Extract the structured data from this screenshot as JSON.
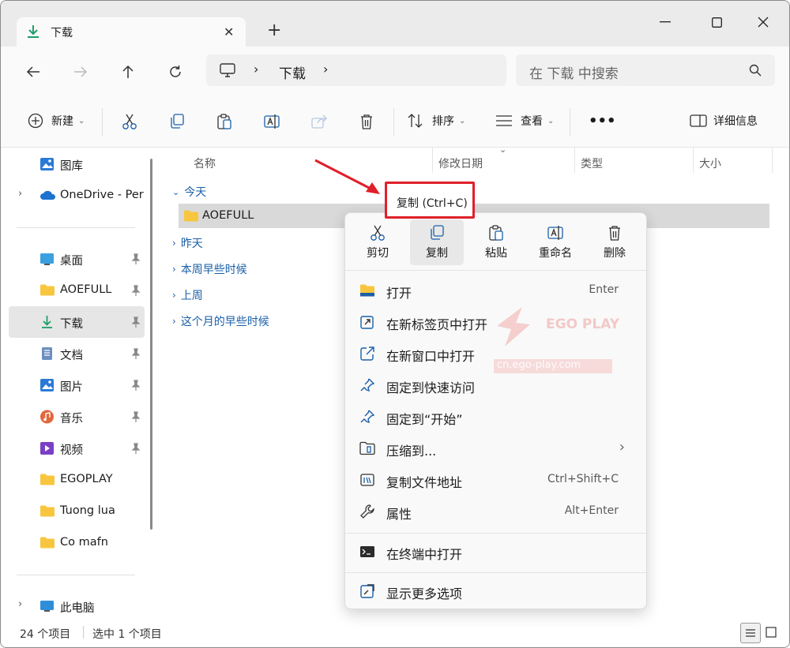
{
  "window": {
    "tab_title": "下载",
    "new_tab_symbol": "+"
  },
  "nav": {
    "address": "下载",
    "search_placeholder": "在 下载 中搜索"
  },
  "toolbar": {
    "new_label": "新建",
    "sort_label": "排序",
    "view_label": "查看",
    "more_label": "•••",
    "details_label": "详细信息"
  },
  "sidebar": {
    "items": [
      {
        "label": "图库",
        "icon": "gallery-icon"
      },
      {
        "label": "OneDrive - Per",
        "icon": "onedrive-icon"
      },
      {
        "label": "桌面",
        "icon": "desktop-icon"
      },
      {
        "label": "AOEFULL",
        "icon": "folder-icon"
      },
      {
        "label": "下载",
        "icon": "download-icon"
      },
      {
        "label": "文档",
        "icon": "document-icon"
      },
      {
        "label": "图片",
        "icon": "pictures-icon"
      },
      {
        "label": "音乐",
        "icon": "music-icon"
      },
      {
        "label": "视频",
        "icon": "video-icon"
      },
      {
        "label": "EGOPLAY",
        "icon": "folder-icon"
      },
      {
        "label": "Tuong lua",
        "icon": "folder-icon"
      },
      {
        "label": "Co mafn",
        "icon": "folder-icon"
      },
      {
        "label": "此电脑",
        "icon": "this-pc-icon"
      }
    ]
  },
  "columns": {
    "name": "名称",
    "modified": "修改日期",
    "type": "类型",
    "size": "大小"
  },
  "groups": {
    "today": "今天",
    "yesterday": "昨天",
    "earlier_week": "本周早些时候",
    "last_week": "上周",
    "earlier_month": "这个月的早些时候"
  },
  "files": [
    {
      "name": "AOEFULL"
    }
  ],
  "tooltip": {
    "text": "复制 (Ctrl+C)"
  },
  "context_menu": {
    "quick_actions": [
      {
        "label": "剪切",
        "icon": "cut-icon"
      },
      {
        "label": "复制",
        "icon": "copy-icon"
      },
      {
        "label": "粘贴",
        "icon": "paste-icon"
      },
      {
        "label": "重命名",
        "icon": "rename-icon"
      },
      {
        "label": "删除",
        "icon": "delete-icon"
      }
    ],
    "items": [
      {
        "label": "打开",
        "shortcut": "Enter",
        "icon": "open-folder-icon"
      },
      {
        "label": "在新标签页中打开",
        "shortcut": "",
        "icon": "new-tab-icon"
      },
      {
        "label": "在新窗口中打开",
        "shortcut": "",
        "icon": "new-window-icon"
      },
      {
        "label": "固定到快速访问",
        "shortcut": "",
        "icon": "pin-icon"
      },
      {
        "label": "固定到“开始”",
        "shortcut": "",
        "icon": "pin-start-icon"
      },
      {
        "label": "压缩到...",
        "shortcut": "",
        "icon": "compress-icon"
      },
      {
        "label": "复制文件地址",
        "shortcut": "Ctrl+Shift+C",
        "icon": "copy-path-icon"
      },
      {
        "label": "属性",
        "shortcut": "Alt+Enter",
        "icon": "properties-icon"
      },
      {
        "label": "在终端中打开",
        "shortcut": "",
        "icon": "terminal-icon"
      },
      {
        "label": "显示更多选项",
        "shortcut": "",
        "icon": "more-options-icon"
      }
    ]
  },
  "status": {
    "count": "24 个项目",
    "selected": "选中 1 个项目"
  },
  "watermark": {
    "brand": "EGO PLAY",
    "url": "cn.ego-play.com"
  },
  "colors": {
    "accent": "#0067c0",
    "folder": "#f8c63e",
    "highlight_box": "#e0202a"
  }
}
